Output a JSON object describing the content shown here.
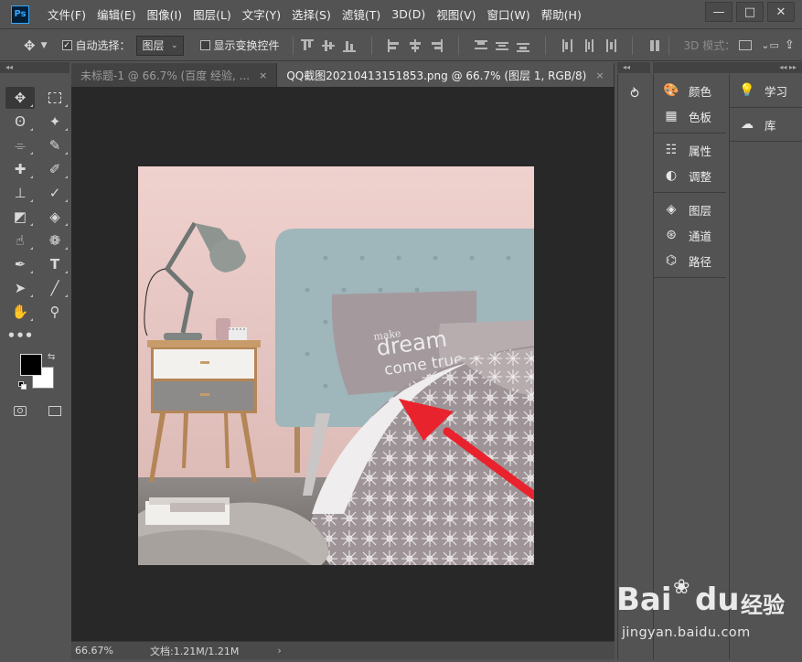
{
  "app": {
    "logo_text": "Ps"
  },
  "menu": [
    "文件(F)",
    "编辑(E)",
    "图像(I)",
    "图层(L)",
    "文字(Y)",
    "选择(S)",
    "滤镜(T)",
    "3D(D)",
    "视图(V)",
    "窗口(W)",
    "帮助(H)"
  ],
  "window_buttons": {
    "minimize": "—",
    "maximize": "□",
    "close": "✕"
  },
  "options": {
    "auto_select_label": "自动选择：",
    "auto_select_checked": true,
    "layer_select_value": "图层",
    "show_transform_label": "显示变换控件",
    "show_transform_checked": false,
    "mode_3d_label": "3D 模式："
  },
  "tabs": [
    {
      "label": "未标题-1 @ 66.7% (百度 经验, ...",
      "active": false,
      "close": "×"
    },
    {
      "label": "QQ截图20210413151853.png @ 66.7% (图层 1, RGB/8)",
      "active": true,
      "close": "×"
    }
  ],
  "status": {
    "zoom": "66.67%",
    "doc": "文档:1.21M/1.21M",
    "arrow": "›"
  },
  "colors": {
    "foreground": "#000000",
    "background": "#ffffff",
    "accent": "#31a8ff",
    "arrow_annotation": "#e8232d"
  },
  "panels": {
    "group1": [
      {
        "icon": "palette-icon",
        "label": "颜色"
      },
      {
        "icon": "swatches-grid-icon",
        "label": "色板"
      }
    ],
    "group2": [
      {
        "icon": "properties-icon",
        "label": "属性"
      },
      {
        "icon": "adjustments-icon",
        "label": "调整"
      }
    ],
    "group3": [
      {
        "icon": "layers-icon",
        "label": "图层"
      },
      {
        "icon": "channels-icon",
        "label": "通道"
      },
      {
        "icon": "paths-icon",
        "label": "路径"
      }
    ],
    "group4": [
      {
        "icon": "lightbulb-icon",
        "label": "学习"
      },
      {
        "icon": "cc-libraries-icon",
        "label": "库"
      }
    ]
  },
  "photo_text": {
    "line1": "make",
    "line2": "dream",
    "line3": "come true"
  },
  "watermark": {
    "brand": "Bai",
    "brand2": "du",
    "brand_cn": "经验",
    "url": "jingyan.baidu.com"
  }
}
